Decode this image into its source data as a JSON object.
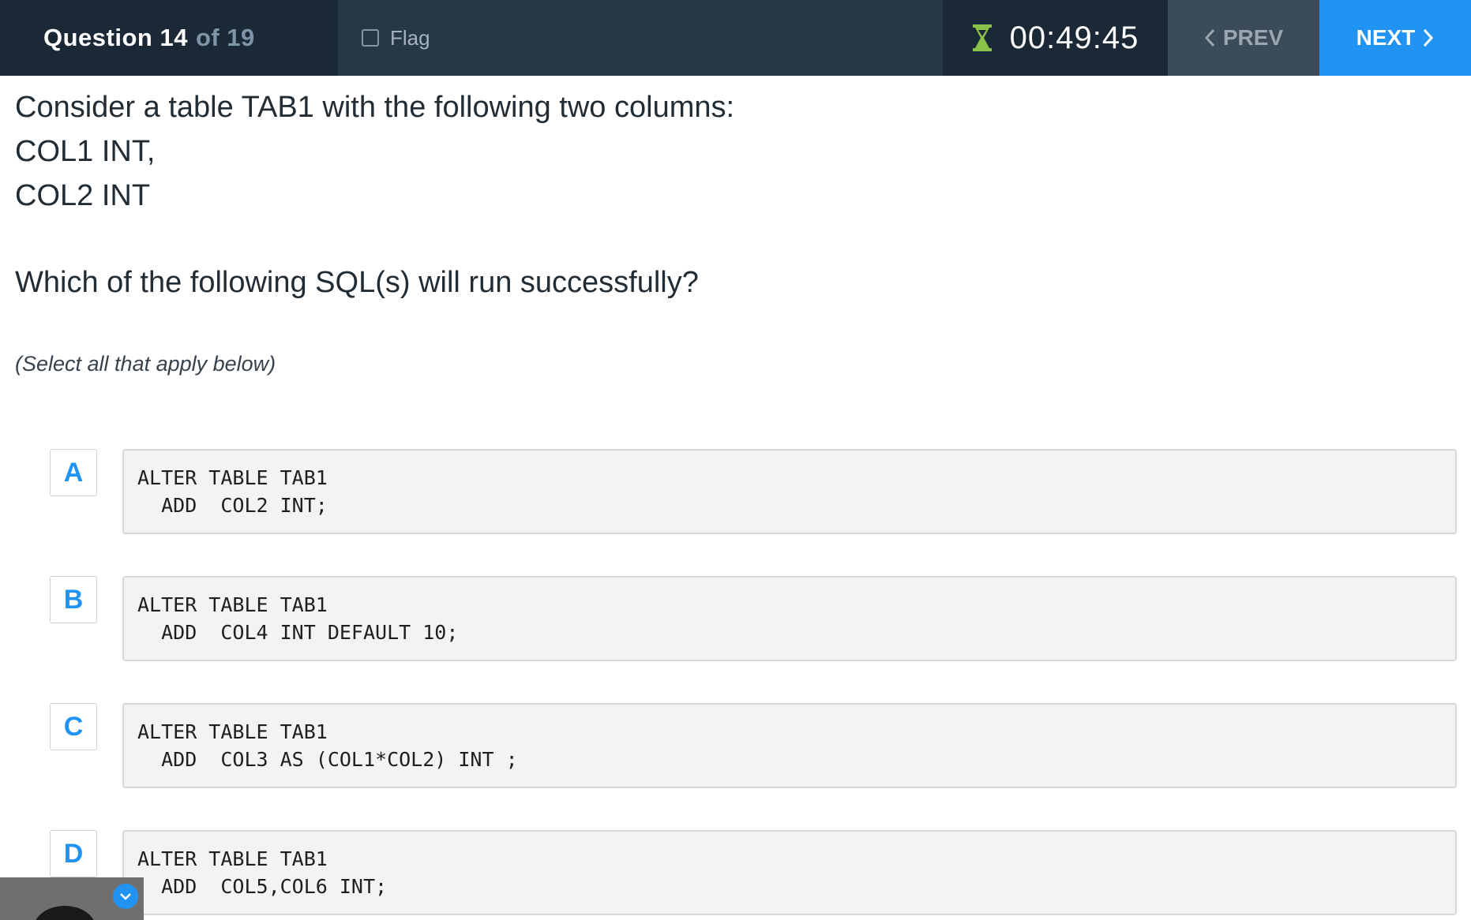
{
  "header": {
    "question_label": "Question 14",
    "question_of": "of 19",
    "flag_label": "Flag",
    "timer": "00:49:45",
    "prev_label": "PREV",
    "next_label": "NEXT"
  },
  "question": {
    "lines": [
      "Consider a table TAB1 with the following two columns:",
      "COL1 INT,",
      "COL2 INT"
    ],
    "prompt": "Which of the following SQL(s) will run successfully?",
    "instruction": "(Select all that apply below)"
  },
  "options": [
    {
      "letter": "A",
      "code": [
        "ALTER TABLE TAB1",
        "  ADD  COL2 INT;"
      ]
    },
    {
      "letter": "B",
      "code": [
        "ALTER TABLE TAB1",
        "  ADD  COL4 INT DEFAULT 10;"
      ]
    },
    {
      "letter": "C",
      "code": [
        "ALTER TABLE TAB1",
        "  ADD  COL3 AS (COL1*COL2) INT ;"
      ]
    },
    {
      "letter": "D",
      "code": [
        "ALTER TABLE TAB1",
        "  ADD  COL5,COL6 INT;"
      ]
    }
  ],
  "colors": {
    "accent": "#2193f3",
    "header_bg": "#1b2936",
    "timer_icon": "#8bc34a"
  }
}
